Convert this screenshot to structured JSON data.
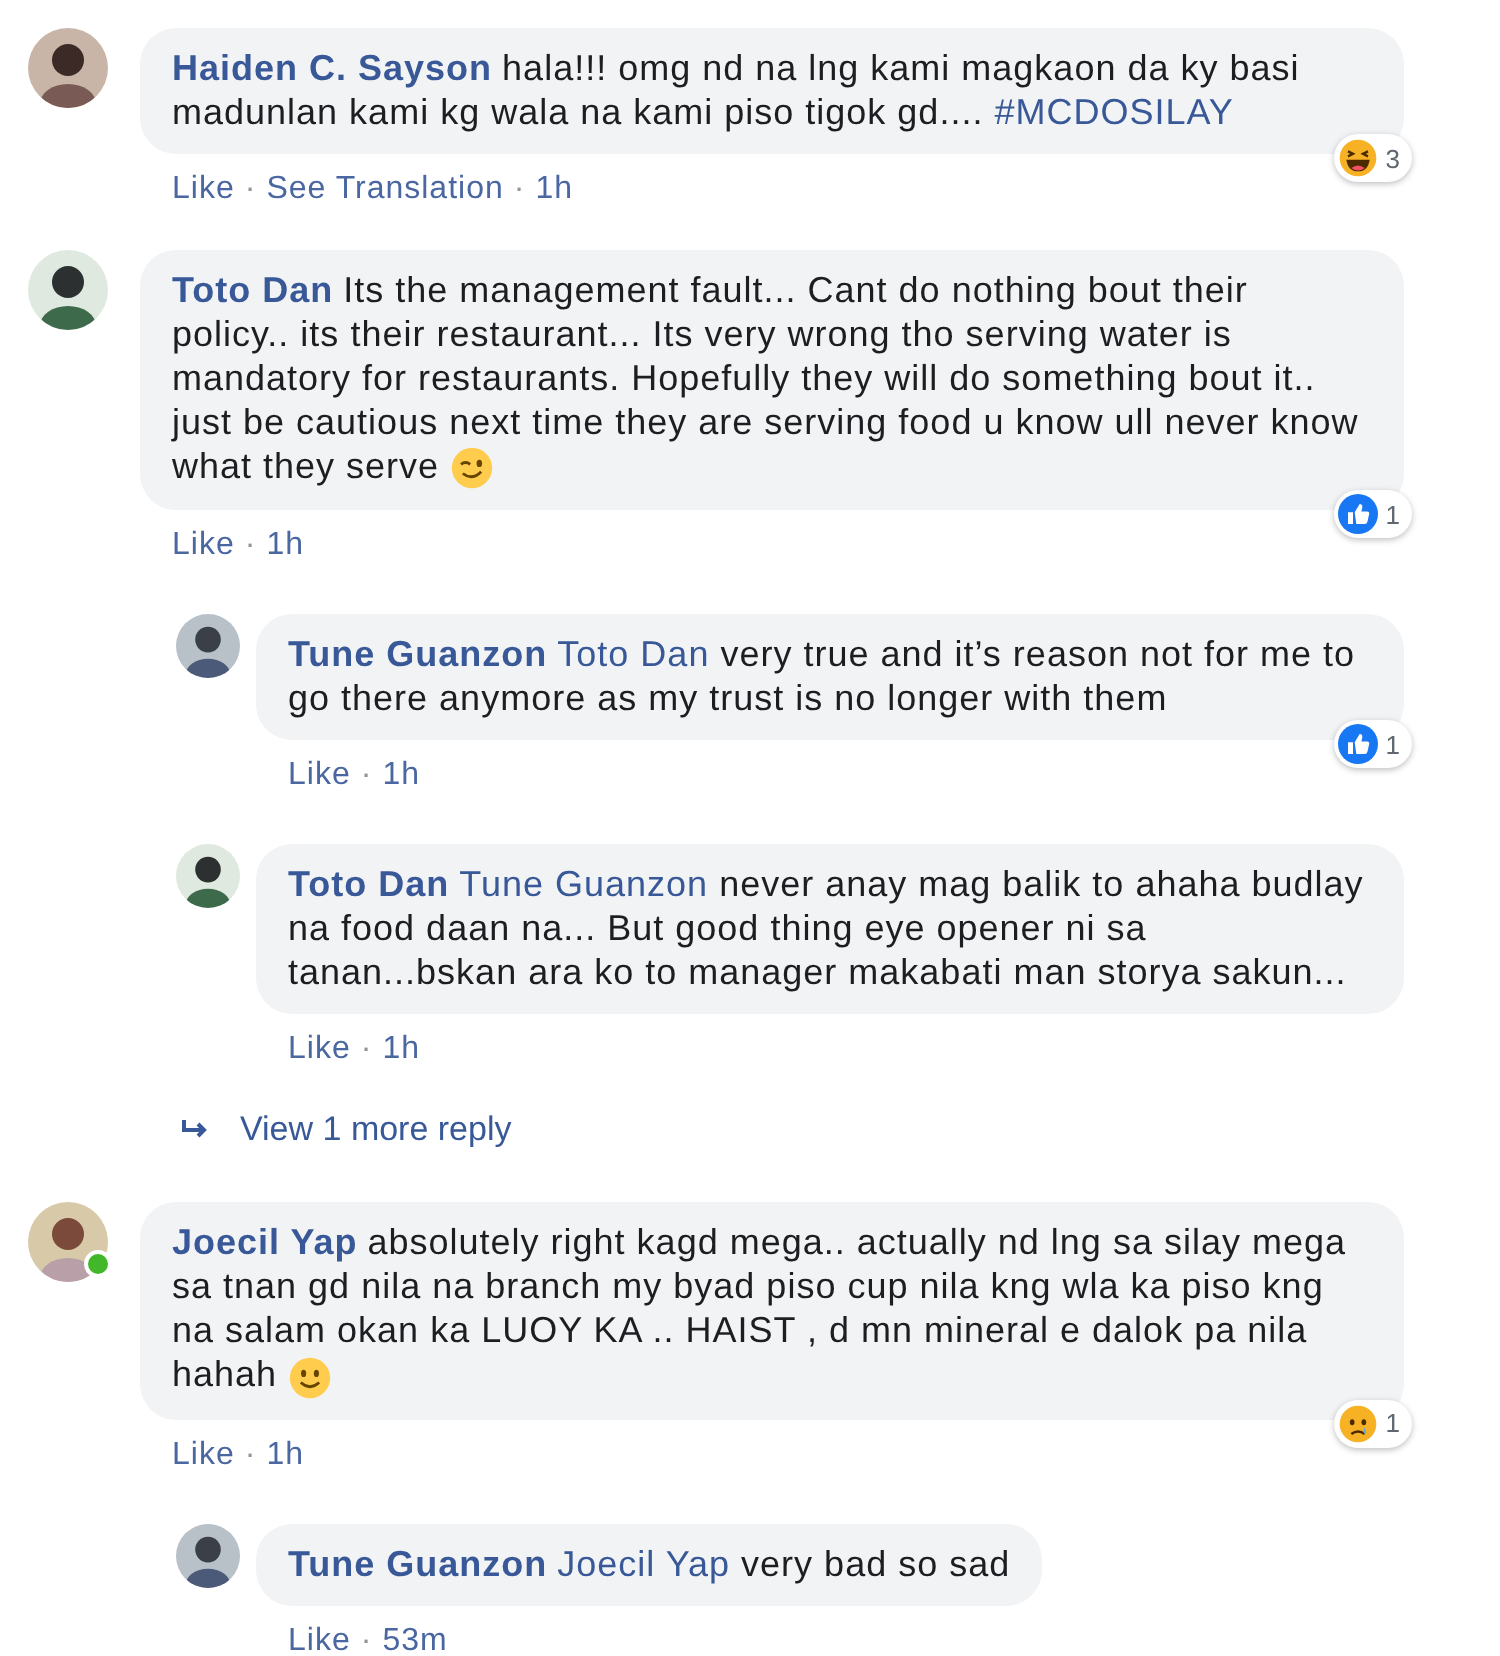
{
  "separator": "·",
  "comments": [
    {
      "author": "Haiden C. Sayson",
      "online": false,
      "body": [
        {
          "kind": "text",
          "text": "hala!!! omg nd na lng kami magkaon da ky basi madunlan kami kg wala na kami piso tigok gd.... "
        },
        {
          "kind": "hashtag",
          "text": "#MCDOSILAY"
        }
      ],
      "actions": [
        "Like",
        "See Translation"
      ],
      "time": "1h",
      "reaction": {
        "kind": "haha",
        "count": "3"
      }
    },
    {
      "author": "Toto Dan",
      "online": false,
      "body": [
        {
          "kind": "text",
          "text": "Its the management fault... Cant do nothing bout their policy.. its their restaurant... Its very wrong tho serving water is mandatory for restaurants. Hopefully they will do something bout it.. just be cautious next time they are serving food u know ull never know what they serve "
        },
        {
          "kind": "wink"
        }
      ],
      "actions": [
        "Like"
      ],
      "time": "1h",
      "reaction": {
        "kind": "like",
        "count": "1"
      },
      "replies": [
        {
          "author": "Tune Guanzon",
          "body": [
            {
              "kind": "mention",
              "text": "Toto Dan"
            },
            {
              "kind": "text",
              "text": " very true and it’s reason not for me to go there anymore as my trust is no longer with them"
            }
          ],
          "actions": [
            "Like"
          ],
          "time": "1h",
          "reaction": {
            "kind": "like",
            "count": "1"
          }
        },
        {
          "author": "Toto Dan",
          "body": [
            {
              "kind": "mention",
              "text": "Tune Guanzon"
            },
            {
              "kind": "text",
              "text": " never anay mag balik to ahaha budlay na food daan na... But good thing eye opener ni sa tanan...bskan ara ko to manager makabati man storya sakun..."
            }
          ],
          "actions": [
            "Like"
          ],
          "time": "1h"
        }
      ],
      "view_more": "View 1 more reply"
    },
    {
      "author": "Joecil Yap",
      "online": true,
      "body": [
        {
          "kind": "text",
          "text": "absolutely right kagd mega.. actually nd lng sa silay mega sa tnan gd nila na branch my byad piso cup nila kng wla ka piso kng na salam okan ka LUOY KA .. HAIST , d mn mineral e dalok pa nila hahah "
        },
        {
          "kind": "smile"
        }
      ],
      "actions": [
        "Like"
      ],
      "time": "1h",
      "reaction": {
        "kind": "sad",
        "count": "1"
      },
      "replies": [
        {
          "author": "Tune Guanzon",
          "body": [
            {
              "kind": "mention",
              "text": "Joecil Yap"
            },
            {
              "kind": "text",
              "text": " very bad so sad"
            }
          ],
          "actions": [
            "Like"
          ],
          "time": "53m"
        }
      ]
    }
  ]
}
